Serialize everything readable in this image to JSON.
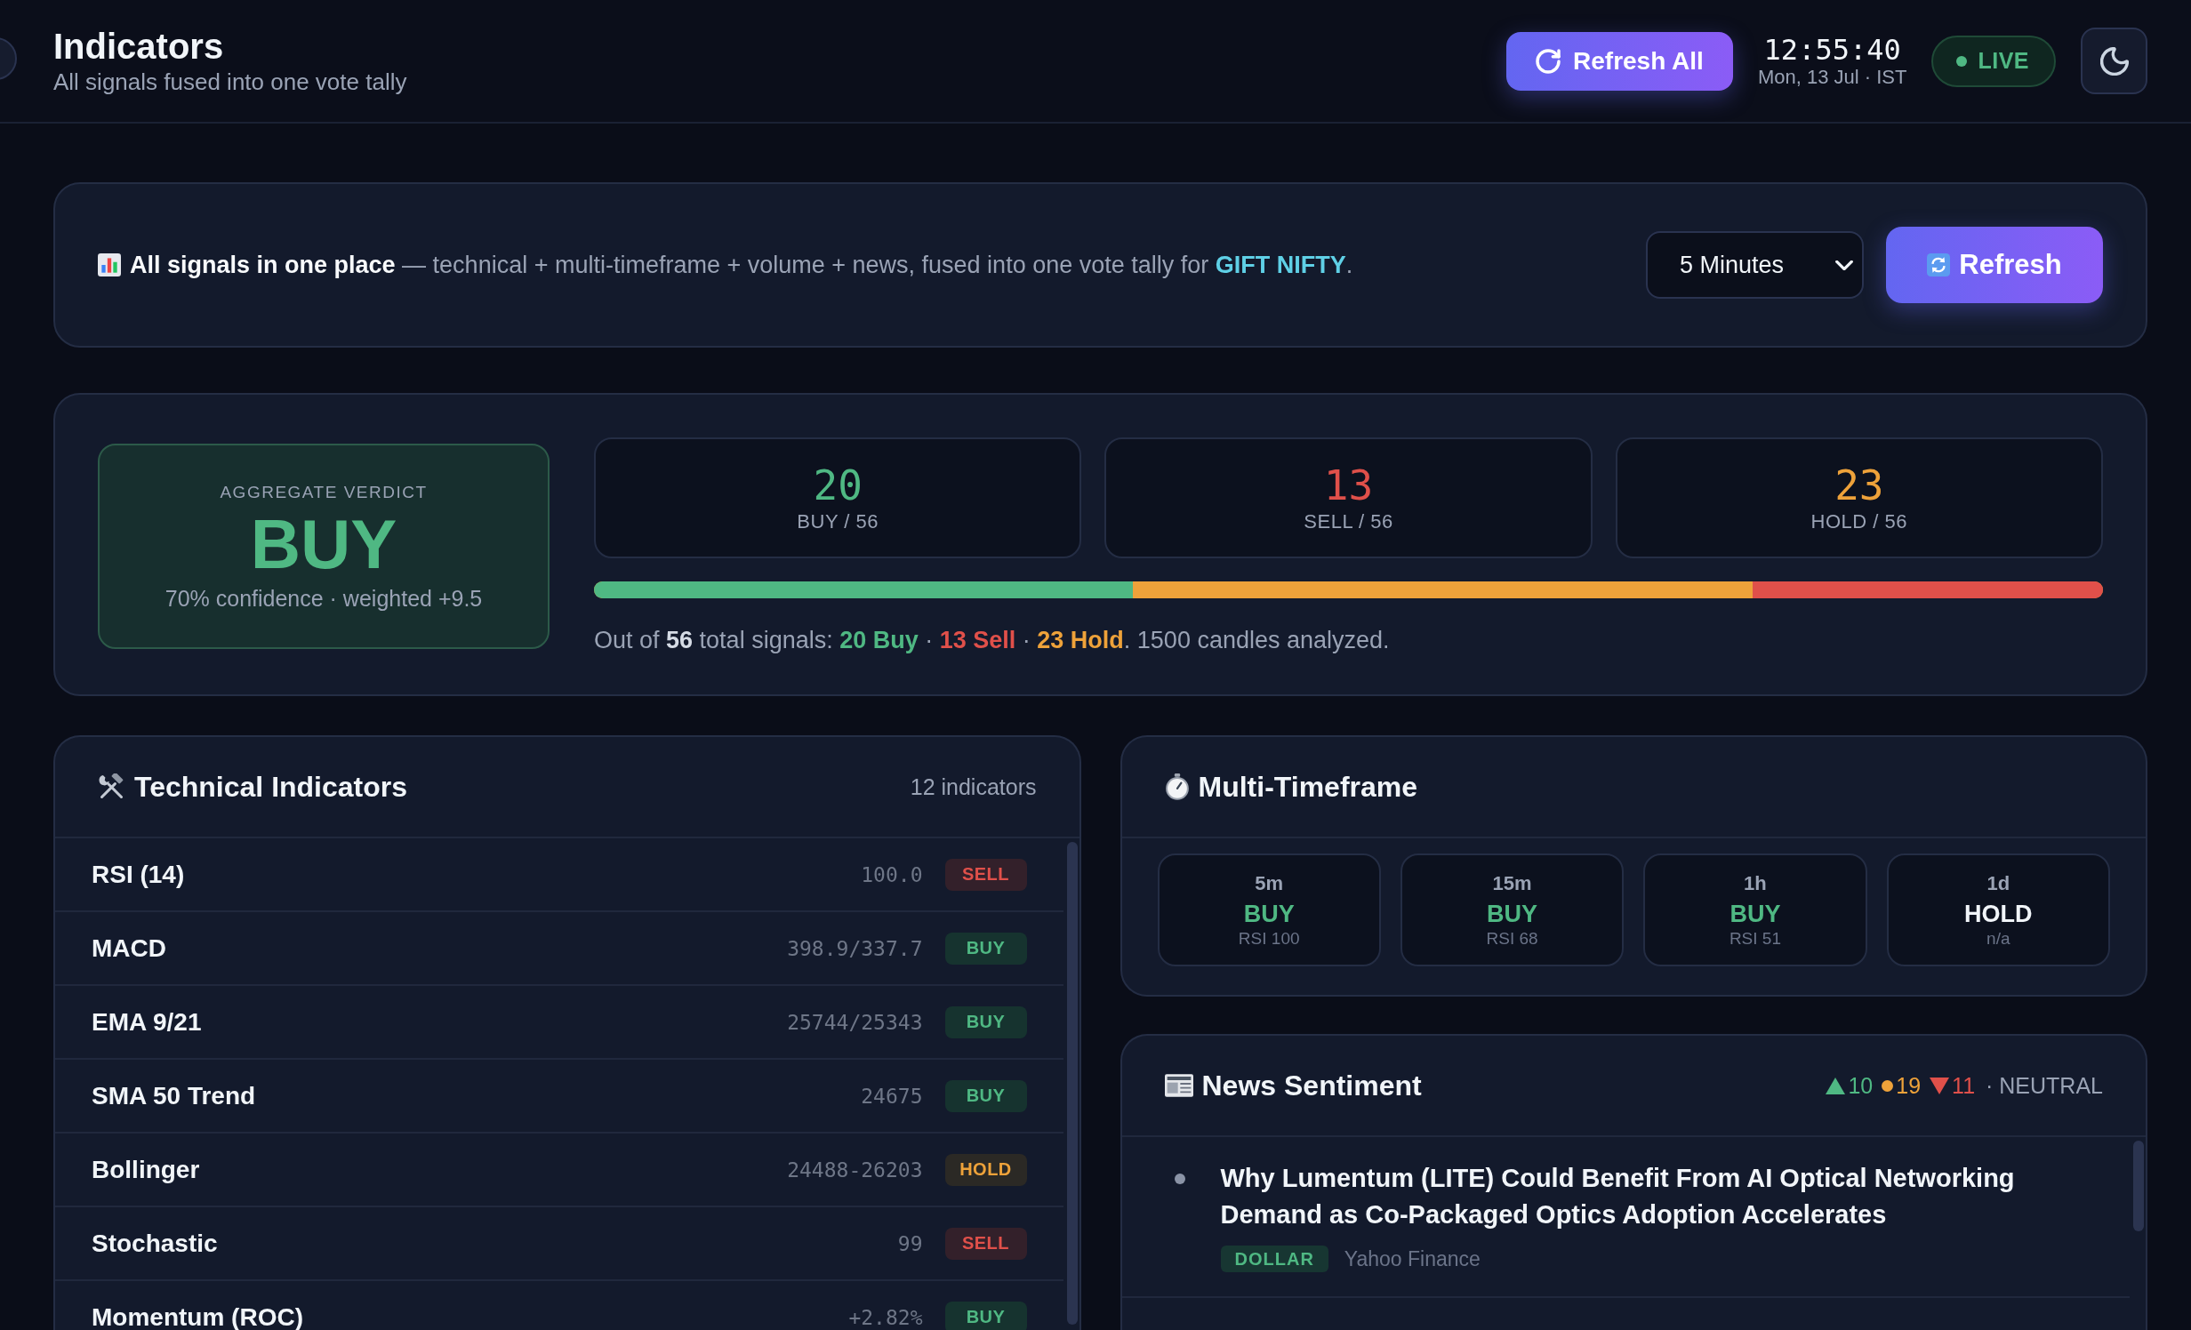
{
  "header": {
    "title": "Indicators",
    "subtitle": "All signals fused into one vote tally",
    "refresh_button": "Refresh All",
    "clock": {
      "time": "12:55:40",
      "date": "Mon, 13 Jul · IST"
    },
    "status": {
      "label": "LIVE",
      "live": true
    }
  },
  "banner": {
    "text": [
      {
        "kind": "lead",
        "text": "All signals in one place"
      },
      {
        "kind": "plain",
        "text": " — technical + multi-timeframe + volume + news, fused into one vote tally for "
      },
      {
        "kind": "symbol",
        "text": "GIFT NIFTY"
      },
      {
        "kind": "plain",
        "text": "."
      }
    ],
    "interval": "5 Minutes",
    "refresh_button": "Refresh"
  },
  "verdict": {
    "label": "AGGREGATE VERDICT",
    "signal": "BUY",
    "kind": "buy",
    "detail": "70% confidence · weighted +9.5"
  },
  "tallies": [
    {
      "kind": "buy",
      "count": "20",
      "label": "BUY / 56"
    },
    {
      "kind": "sell",
      "count": "13",
      "label": "SELL / 56"
    },
    {
      "kind": "hold",
      "count": "23",
      "label": "HOLD / 56"
    }
  ],
  "tally_bar": {
    "kind": "hold",
    "segments": [
      {
        "kind": "buy",
        "level": 0.357
      },
      {
        "kind": "sell",
        "level": 0.232
      }
    ]
  },
  "summary": [
    {
      "kind": "plain",
      "text": "Out of "
    },
    {
      "kind": "total",
      "text": "56"
    },
    {
      "kind": "plain",
      "text": " total signals: "
    },
    {
      "kind": "buy",
      "text": "20 Buy"
    },
    {
      "kind": "plain",
      "text": " · "
    },
    {
      "kind": "sell",
      "text": "13 Sell"
    },
    {
      "kind": "plain",
      "text": " · "
    },
    {
      "kind": "hold",
      "text": "23 Hold"
    },
    {
      "kind": "plain",
      "text": ". 1500 candles analyzed."
    }
  ],
  "technical": {
    "title": "Technical Indicators",
    "count": "12 indicators",
    "rows": [
      {
        "name": "RSI (14)",
        "value": "100.0",
        "signal": "SELL",
        "kind": "sell"
      },
      {
        "name": "MACD",
        "value": "398.9/337.7",
        "signal": "BUY",
        "kind": "buy"
      },
      {
        "name": "EMA 9/21",
        "value": "25744/25343",
        "signal": "BUY",
        "kind": "buy"
      },
      {
        "name": "SMA 50 Trend",
        "value": "24675",
        "signal": "BUY",
        "kind": "buy"
      },
      {
        "name": "Bollinger",
        "value": "24488-26203",
        "signal": "HOLD",
        "kind": "hold"
      },
      {
        "name": "Stochastic",
        "value": "99",
        "signal": "SELL",
        "kind": "sell"
      },
      {
        "name": "Momentum (ROC)",
        "value": "+2.82%",
        "signal": "BUY",
        "kind": "buy"
      }
    ]
  },
  "multi_timeframe": {
    "title": "Multi-Timeframe",
    "tiles": [
      {
        "timeframe": "5m",
        "signal": "BUY",
        "kind": "buy",
        "detail": "RSI 100"
      },
      {
        "timeframe": "15m",
        "signal": "BUY",
        "kind": "buy",
        "detail": "RSI 68"
      },
      {
        "timeframe": "1h",
        "signal": "BUY",
        "kind": "buy",
        "detail": "RSI 51"
      },
      {
        "timeframe": "1d",
        "signal": "HOLD",
        "kind": "hold",
        "detail": "n/a"
      }
    ]
  },
  "news": {
    "title": "News Sentiment",
    "sentiment": {
      "counts": [
        {
          "kind": "up",
          "count": "10"
        },
        {
          "kind": "neutral",
          "count": "19"
        },
        {
          "kind": "down",
          "count": "11"
        }
      ],
      "label": "· NEUTRAL"
    },
    "items": [
      {
        "headline": "Why Lumentum (LITE) Could Benefit From AI Optical Networking Demand as Co-Packaged Optics Adoption Accelerates",
        "tag": "DOLLAR",
        "source": "Yahoo Finance"
      }
    ]
  }
}
